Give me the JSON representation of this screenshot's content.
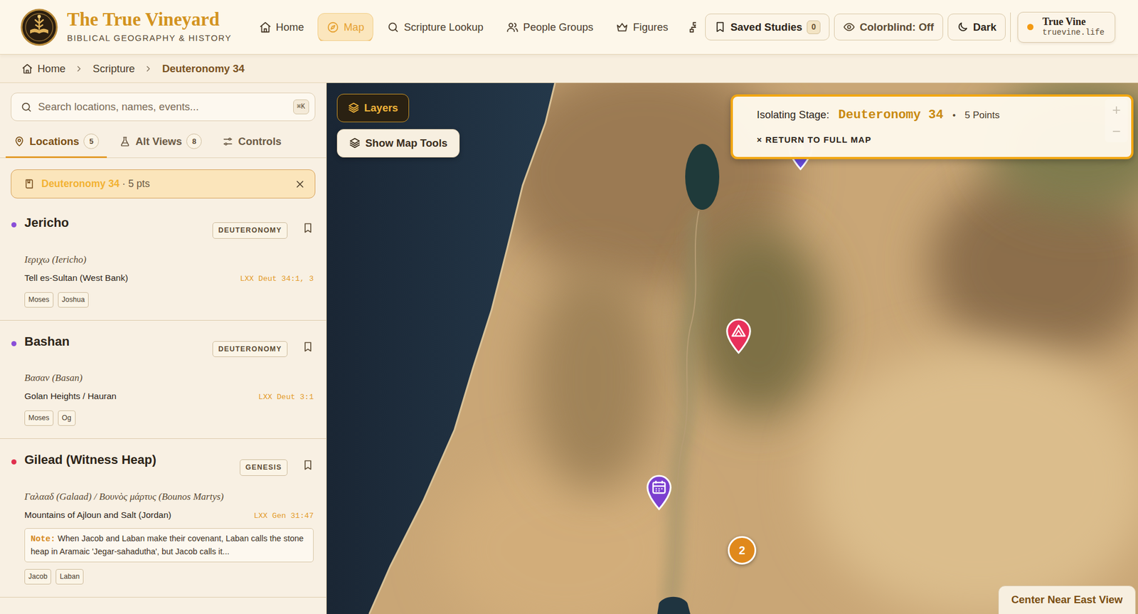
{
  "brand": {
    "title": "The True Vineyard",
    "subtitle": "BIBLICAL GEOGRAPHY & HISTORY"
  },
  "nav": [
    {
      "label": "Home",
      "selected": false
    },
    {
      "label": "Map",
      "selected": true
    },
    {
      "label": "Scripture Lookup",
      "selected": false
    },
    {
      "label": "People Groups",
      "selected": false
    },
    {
      "label": "Figures",
      "selected": false
    }
  ],
  "saved": {
    "label": "Saved Studies",
    "count": "0"
  },
  "colorblind": {
    "label": "Colorblind: Off"
  },
  "theme": {
    "label": "Dark"
  },
  "account": {
    "name": "True Vine",
    "domain": "truevine.life"
  },
  "breadcrumb": [
    "Home",
    "Scripture",
    "Deuteronomy 34"
  ],
  "search": {
    "placeholder": "Search locations, names, events...",
    "shortcut": "⌘K"
  },
  "tabs": [
    {
      "label": "Locations",
      "count": "5",
      "selected": true
    },
    {
      "label": "Alt Views",
      "count": "8",
      "selected": false
    },
    {
      "label": "Controls",
      "selected": false
    }
  ],
  "filter": {
    "label": "Deuteronomy 34",
    "detail": "· 5 pts"
  },
  "locations": [
    {
      "name": "Jericho",
      "book": "DEUTERONOMY",
      "greek": "Ιεριχω (Iericho)",
      "site": "Tell es-Sultan (West Bank)",
      "ref": "LXX Deut 34:1, 3",
      "tags": [
        "Moses",
        "Joshua"
      ],
      "color": "#8a4fd8"
    },
    {
      "name": "Bashan",
      "book": "DEUTERONOMY",
      "greek": "Βασαν (Basan)",
      "site": "Golan Heights / Hauran",
      "ref": "LXX Deut 3:1",
      "tags": [
        "Moses",
        "Og"
      ],
      "color": "#8a4fd8"
    },
    {
      "name": "Gilead (Witness Heap)",
      "book": "GENESIS",
      "greek": "Γαλααδ (Galaad) / Βουνὸς μάρτυς (Bounos Martys)",
      "site": "Mountains of Ajloun and Salt (Jordan)",
      "ref": "LXX Gen 31:47",
      "note_label": "Note:",
      "note": "When Jacob and Laban make their covenant, Laban calls the stone heap in Aramaic 'Jegar-sahadutha', but Jacob calls it...",
      "tags": [
        "Jacob",
        "Laban"
      ],
      "color": "#e0304e"
    }
  ],
  "map": {
    "layers": "Layers",
    "tools": "Show Map Tools",
    "stage": {
      "prefix": "Isolating Stage:",
      "name": "Deuteronomy 34",
      "dot": "•",
      "count": "5 Points",
      "return": "× RETURN TO FULL MAP"
    },
    "zoom": [
      "+",
      "−"
    ],
    "pins": [
      {
        "kind": "place",
        "color": "#6a4de0"
      },
      {
        "kind": "mountain",
        "color": "#e8305a"
      },
      {
        "kind": "event",
        "color": "#7b3fd0"
      },
      {
        "kind": "cluster",
        "label": "2",
        "color": "#e0891c"
      }
    ],
    "center": "Center Near East View"
  }
}
